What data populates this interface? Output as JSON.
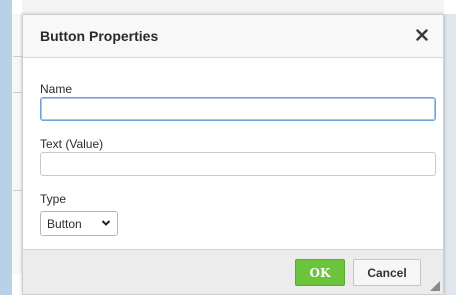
{
  "dialog": {
    "title": "Button Properties",
    "close_icon": "close-icon"
  },
  "form": {
    "name_label": "Name",
    "name_value": "",
    "text_label": "Text (Value)",
    "text_value": "",
    "type_label": "Type",
    "type_selected": "Button",
    "type_options": [
      "Button"
    ]
  },
  "footer": {
    "ok_label": "OK",
    "cancel_label": "Cancel"
  },
  "colors": {
    "ok_green": "#6cc43d",
    "focus_blue": "#6fa1d6",
    "backdrop": "#b9d0e9"
  }
}
